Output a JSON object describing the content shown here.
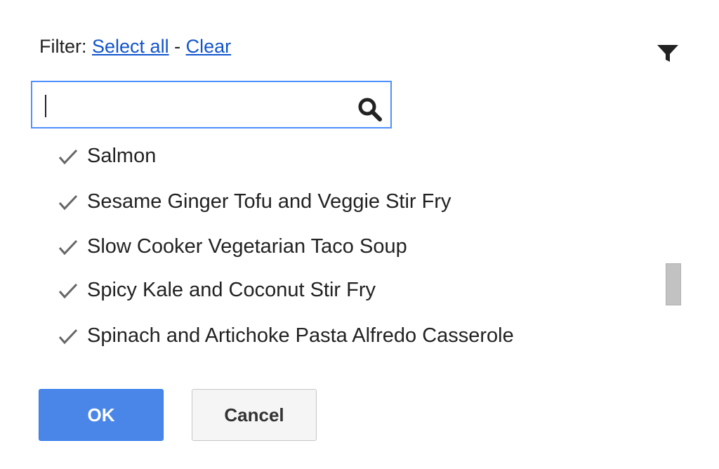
{
  "filter": {
    "label": "Filter:",
    "select_all_label": "Select all",
    "separator": "-",
    "clear_label": "Clear",
    "funnel_icon": "filter-funnel-icon"
  },
  "search": {
    "value": "",
    "placeholder": "",
    "icon": "search-icon"
  },
  "list": {
    "items": [
      {
        "label": "Salmon",
        "checked": true
      },
      {
        "label": "Sesame Ginger Tofu and Veggie Stir Fry",
        "checked": true
      },
      {
        "label": "Slow Cooker Vegetarian Taco Soup",
        "checked": true
      },
      {
        "label": "Spicy Kale and Coconut Stir Fry",
        "checked": true
      },
      {
        "label": "Spinach and Artichoke Pasta Alfredo Casserole",
        "checked": true
      }
    ]
  },
  "buttons": {
    "ok_label": "OK",
    "cancel_label": "Cancel"
  },
  "colors": {
    "link": "#1155cc",
    "focus_border": "#4d90fe",
    "ok_button": "#4a86e8",
    "scroll_thumb": "#c2c2c2"
  }
}
